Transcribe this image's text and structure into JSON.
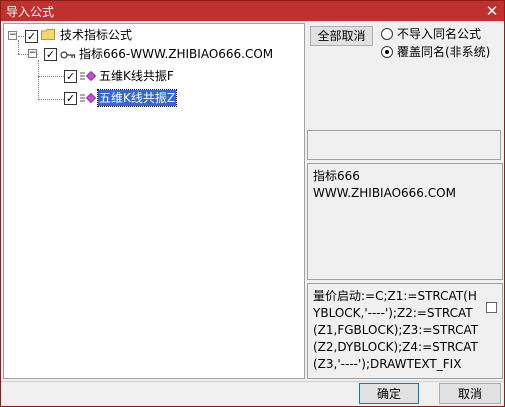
{
  "window": {
    "title": "导入公式",
    "close_glyph": "✕"
  },
  "tree": {
    "root": {
      "label": "技术指标公式",
      "expanded_glyph": "−",
      "checked_glyph": "✓"
    },
    "child": {
      "label": "指标666-WWW.ZHIBIAO666.COM",
      "expanded_glyph": "−",
      "checked_glyph": "✓"
    },
    "leaves": [
      {
        "label": "五维K线共振F",
        "checked_glyph": "✓",
        "selected": false
      },
      {
        "label": "五维K线共振Z",
        "checked_glyph": "✓",
        "selected": true
      }
    ]
  },
  "options": {
    "deselect_all_label": "全部取消",
    "radio_no_import": "不导入同名公式",
    "radio_overwrite": "覆盖同名(非系统)"
  },
  "description": {
    "line1": "指标666",
    "line2": "WWW.ZHIBIAO666.COM"
  },
  "formula": {
    "text": "量价启动:=C;Z1:=STRCAT(HYBLOCK,'----');Z2:=STRCAT(Z1,FGBLOCK);Z3:=STRCAT(Z2,DYBLOCK);Z4:=STRCAT(Z3,'----');DRAWTEXT_FIX"
  },
  "footer": {
    "ok_label": "确定",
    "cancel_label": "取消"
  },
  "colors": {
    "titlebar": "#c0302e",
    "selection": "#3367d6",
    "folder": "#f5d76e"
  }
}
